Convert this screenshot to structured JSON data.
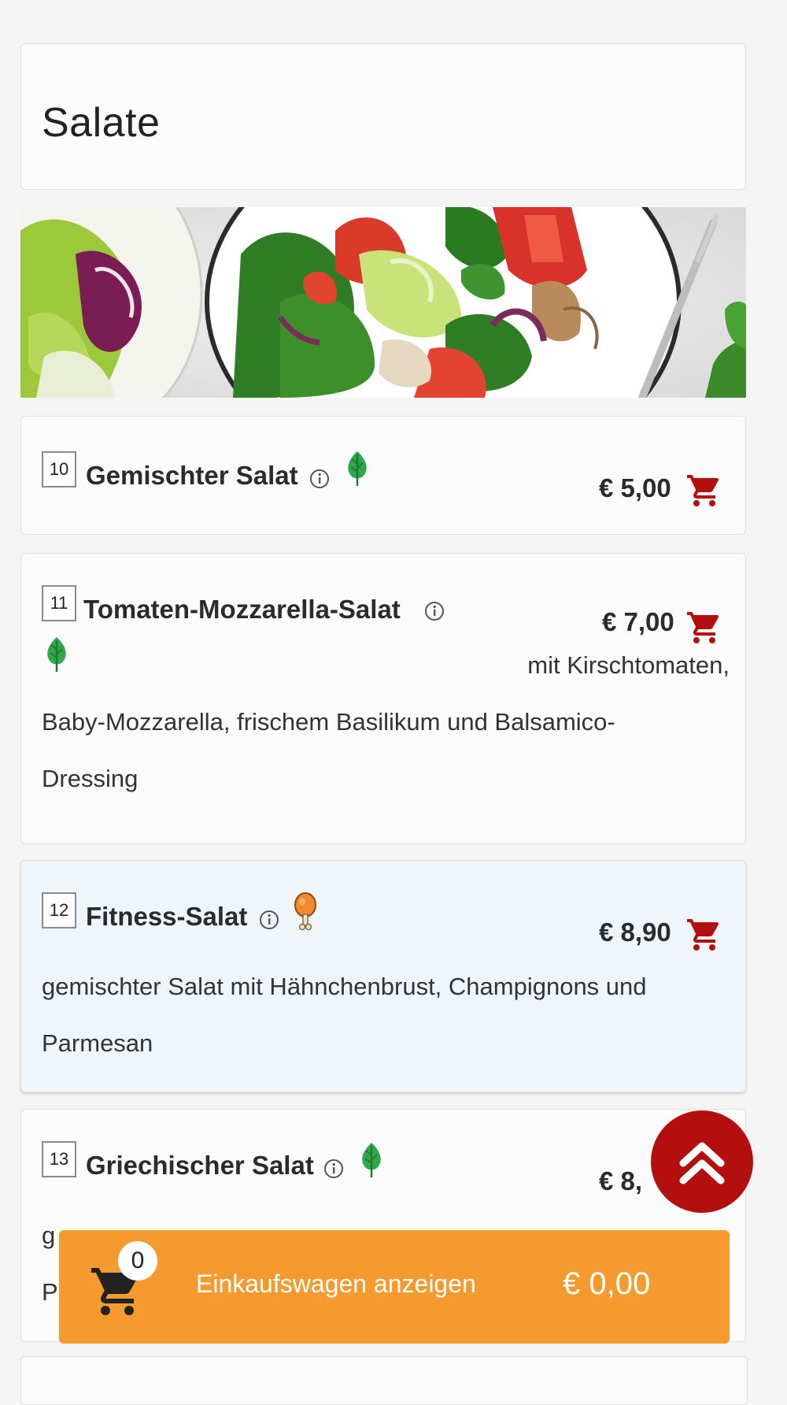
{
  "section": {
    "title": "Salate"
  },
  "items": [
    {
      "number": "10",
      "name": "Gemischter Salat",
      "price": "€ 5,00",
      "badge": "leaf-icon",
      "description": ""
    },
    {
      "number": "11",
      "name": "Tomaten-Mozzarella-Salat",
      "price": "€ 7,00",
      "badge": "leaf-icon",
      "description_lines": [
        "mit Kirschtomaten,",
        "Baby-Mozzarella, frischem Basilikum und Balsamico-",
        "Dressing"
      ]
    },
    {
      "number": "12",
      "name": "Fitness-Salat",
      "price": "€ 8,90",
      "badge": "chicken-leg-icon",
      "description_lines": [
        "gemischter Salat mit Hähnchenbrust, Champignons und",
        "Parmesan"
      ]
    },
    {
      "number": "13",
      "name": "Griechischer Salat",
      "price": "€ 8,",
      "badge": "leaf-icon",
      "description_lines": [
        "g",
        "P"
      ]
    }
  ],
  "cart": {
    "count": "0",
    "label": "Einkaufswagen anzeigen",
    "total": "€ 0,00"
  },
  "colors": {
    "accent_red": "#b30f0f",
    "cart_orange": "#f59a2f",
    "leaf_green": "#2ea84a",
    "highlight_blue": "#eef5fb"
  }
}
